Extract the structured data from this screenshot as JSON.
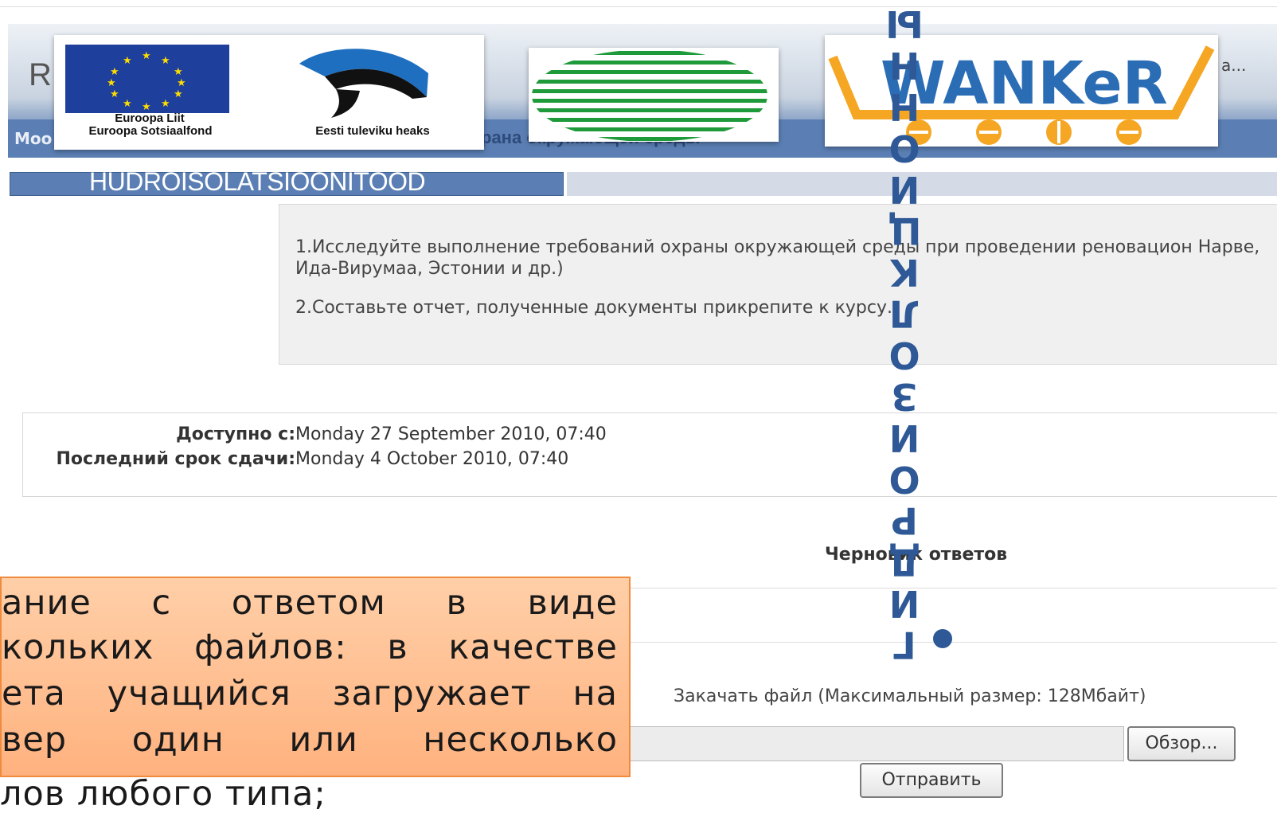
{
  "header": {
    "site_initial": "R",
    "nav_left": "Moo",
    "nav_mid": "рана окружающей среды",
    "search_snippet": "а..."
  },
  "logos": {
    "eu_line1": "Euroopa Liit",
    "eu_line2": "Euroopa Sotsiaalfond",
    "estonia_caption": "Eesti tuleviku heaks",
    "wanker_text": "WANKeR",
    "colors": {
      "eu_blue": "#1e3f9b",
      "eu_star": "#ffdd00",
      "green": "#1f9a3a",
      "orange": "#f5a623",
      "wanker_blue": "#2a6db5"
    }
  },
  "section": {
    "title": "HUDROISOLATSIOONITOOD"
  },
  "intro": {
    "p1": "1.Исследуйте выполнение требований охраны окружающей среды при проведении реновацион Нарве, Ида-Вирумаа, Эстонии и др.)",
    "p2": "2.Составьте отчет, полученные документы прикрепите к курсу."
  },
  "dates": {
    "available_label": "Доступно с:",
    "available_value": "Monday 27 September 2010, 07:40",
    "due_label": "Последний срок сдачи:",
    "due_value": "Monday 4 October 2010, 07:40"
  },
  "draft": {
    "title": "Черновик ответов"
  },
  "upload": {
    "label": "Закачать файл (Максимальный размер: 128Мбайт)",
    "browse": "Обзор...",
    "submit": "Отправить"
  },
  "callout": {
    "line1": "ание с ответом в виде",
    "line2": "кольких файлов: в качестве",
    "line3": "ета учащийся загружает на",
    "line4": "вер один или несколько",
    "line5": "лов любого типа;"
  },
  "overlay": {
    "vertical_chars": [
      "Ы",
      "Н",
      "Н",
      "О",
      "И",
      "Ц",
      "К",
      "Л",
      "О",
      "З",
      "И",
      "О",
      "Р",
      "Д",
      "И",
      "Г"
    ]
  }
}
